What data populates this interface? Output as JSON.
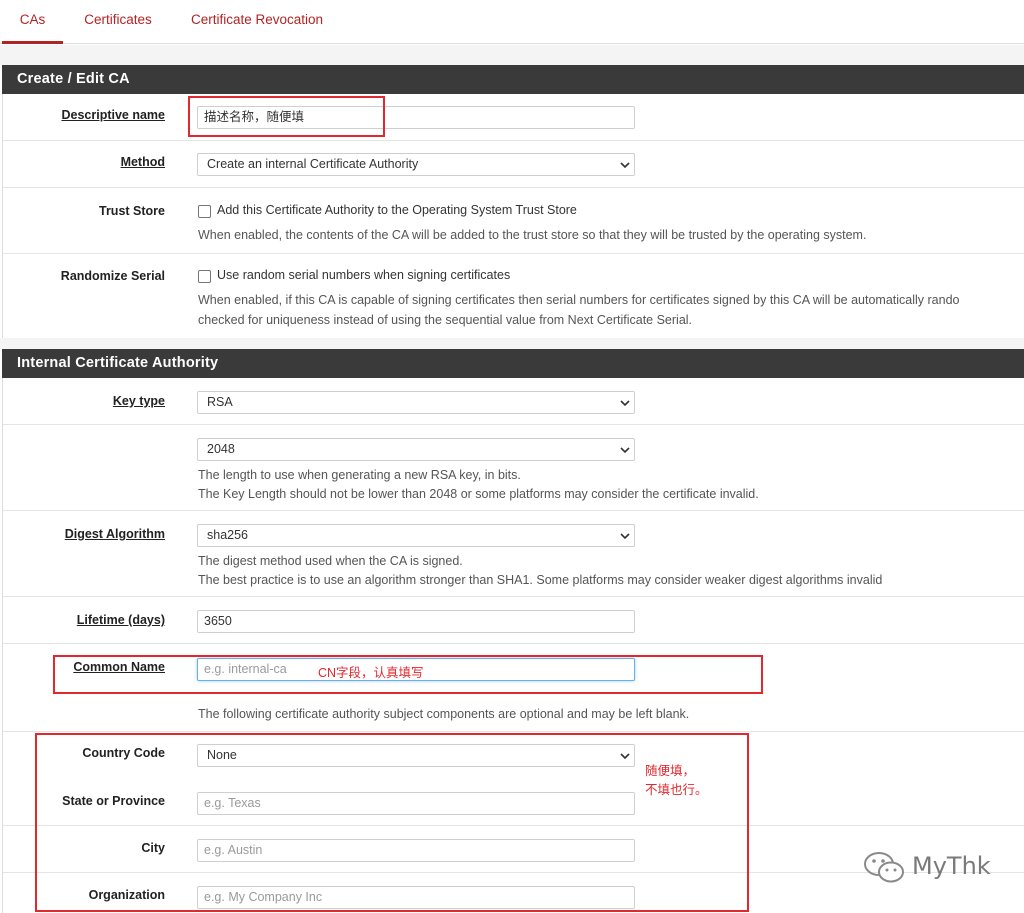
{
  "tabs": [
    "CAs",
    "Certificates",
    "Certificate Revocation"
  ],
  "panel1": {
    "title": "Create / Edit CA",
    "descriptive_name": {
      "label": "Descriptive name",
      "value": "描述名称，随便填"
    },
    "method": {
      "label": "Method",
      "value": "Create an internal Certificate Authority"
    },
    "trust_store": {
      "label": "Trust Store",
      "checkbox_label": "Add this Certificate Authority to the Operating System Trust Store",
      "help": "When enabled, the contents of the CA will be added to the trust store so that they will be trusted by the operating system."
    },
    "randomize_serial": {
      "label": "Randomize Serial",
      "checkbox_label": "Use random serial numbers when signing certificates",
      "help1": "When enabled, if this CA is capable of signing certificates then serial numbers for certificates signed by this CA will be automatically rando",
      "help2": "checked for uniqueness instead of using the sequential value from Next Certificate Serial."
    }
  },
  "panel2": {
    "title": "Internal Certificate Authority",
    "key_type": {
      "label": "Key type",
      "value": "RSA"
    },
    "key_length": {
      "value": "2048",
      "help1": "The length to use when generating a new RSA key, in bits.",
      "help2": "The Key Length should not be lower than 2048 or some platforms may consider the certificate invalid."
    },
    "digest": {
      "label": "Digest Algorithm",
      "value": "sha256",
      "help1": "The digest method used when the CA is signed.",
      "help2": "The best practice is to use an algorithm stronger than SHA1. Some platforms may consider weaker digest algorithms invalid"
    },
    "lifetime": {
      "label": "Lifetime (days)",
      "value": "3650"
    },
    "common_name": {
      "label": "Common Name",
      "placeholder": "e.g. internal-ca"
    },
    "optional_note": "The following certificate authority subject components are optional and may be left blank.",
    "country_code": {
      "label": "Country Code",
      "value": "None"
    },
    "state": {
      "label": "State or Province",
      "placeholder": "e.g. Texas"
    },
    "city": {
      "label": "City",
      "placeholder": "e.g. Austin"
    },
    "organization": {
      "label": "Organization",
      "placeholder": "e.g. My Company Inc"
    }
  },
  "annotations": {
    "cn_note": "CN字段，认真填写",
    "optional_note_line1": "随便填，",
    "optional_note_line2": "不填也行。"
  },
  "watermark": "MyThk",
  "colors": {
    "accent": "#b22323",
    "panel_header": "#3a3a3a",
    "annotation": "#e0282e"
  }
}
